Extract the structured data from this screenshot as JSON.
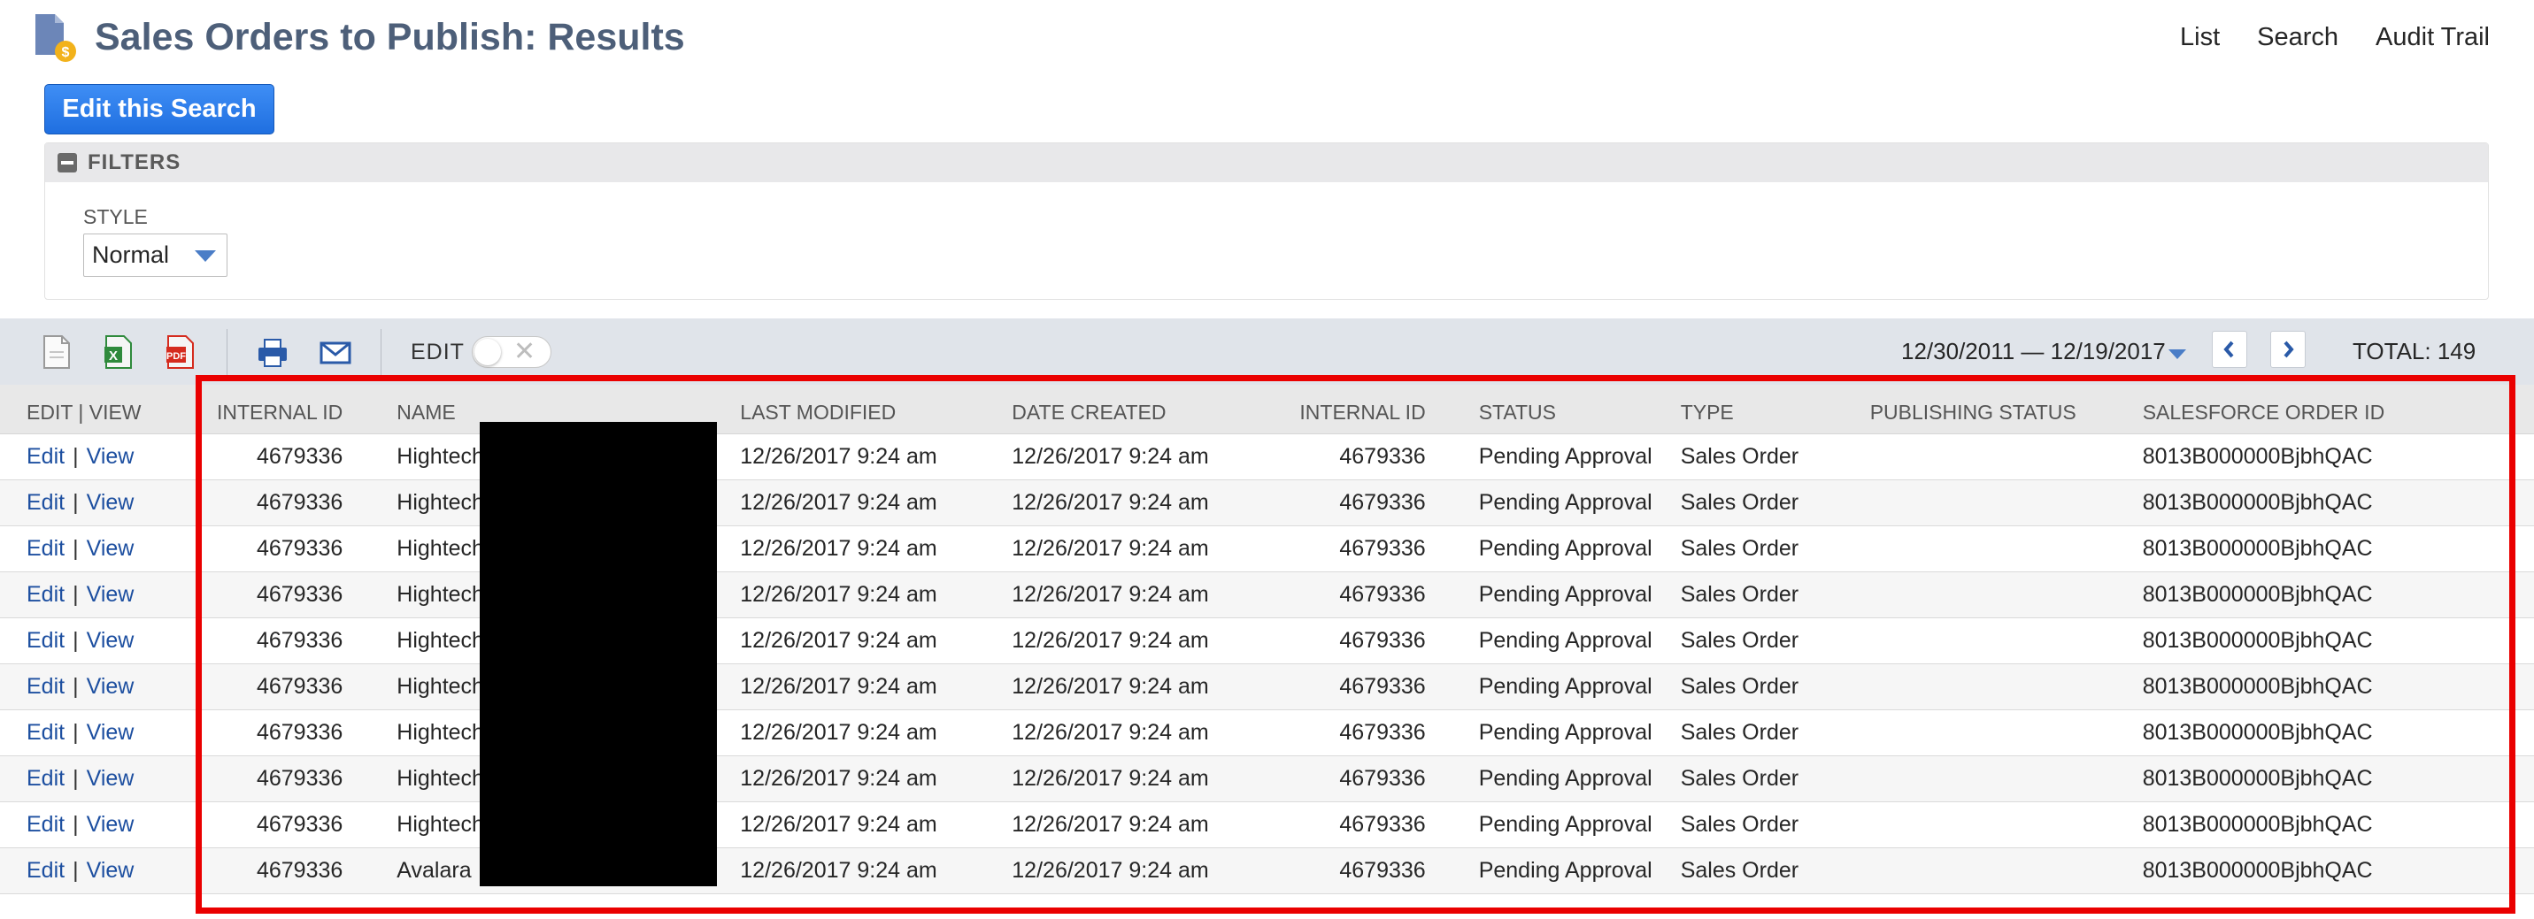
{
  "header": {
    "title": "Sales Orders to Publish: Results",
    "links": [
      "List",
      "Search",
      "Audit Trail"
    ],
    "edit_search_label": "Edit this Search"
  },
  "filters": {
    "title": "FILTERS",
    "style_label": "STYLE",
    "style_value": "Normal"
  },
  "toolbar": {
    "icons": [
      "export-csv-icon",
      "export-excel-icon",
      "export-pdf-icon",
      "print-icon",
      "email-icon"
    ],
    "edit_label": "EDIT",
    "date_range": "12/30/2011 — 12/19/2017",
    "total": "TOTAL: 149"
  },
  "table": {
    "columns": [
      "EDIT | VIEW",
      "INTERNAL ID",
      "NAME",
      "LAST MODIFIED",
      "DATE CREATED",
      "INTERNAL ID",
      "STATUS",
      "TYPE",
      "PUBLISHING STATUS",
      "SALESFORCE ORDER ID"
    ],
    "edit_label": "Edit",
    "view_label": "View",
    "separator": "|",
    "rows": [
      {
        "id": "4679336",
        "name": "Hightech",
        "last_modified": "12/26/2017 9:24 am",
        "date_created": "12/26/2017 9:24 am",
        "id2": "4679336",
        "status": "Pending Approval",
        "type": "Sales Order",
        "publishing_status": "",
        "sf_order_id": "8013B000000BjbhQAC"
      },
      {
        "id": "4679336",
        "name": "Hightech",
        "last_modified": "12/26/2017 9:24 am",
        "date_created": "12/26/2017 9:24 am",
        "id2": "4679336",
        "status": "Pending Approval",
        "type": "Sales Order",
        "publishing_status": "",
        "sf_order_id": "8013B000000BjbhQAC"
      },
      {
        "id": "4679336",
        "name": "Hightech",
        "last_modified": "12/26/2017 9:24 am",
        "date_created": "12/26/2017 9:24 am",
        "id2": "4679336",
        "status": "Pending Approval",
        "type": "Sales Order",
        "publishing_status": "",
        "sf_order_id": "8013B000000BjbhQAC"
      },
      {
        "id": "4679336",
        "name": "Hightech",
        "last_modified": "12/26/2017 9:24 am",
        "date_created": "12/26/2017 9:24 am",
        "id2": "4679336",
        "status": "Pending Approval",
        "type": "Sales Order",
        "publishing_status": "",
        "sf_order_id": "8013B000000BjbhQAC"
      },
      {
        "id": "4679336",
        "name": "Hightech",
        "last_modified": "12/26/2017 9:24 am",
        "date_created": "12/26/2017 9:24 am",
        "id2": "4679336",
        "status": "Pending Approval",
        "type": "Sales Order",
        "publishing_status": "",
        "sf_order_id": "8013B000000BjbhQAC"
      },
      {
        "id": "4679336",
        "name": "Hightech",
        "last_modified": "12/26/2017 9:24 am",
        "date_created": "12/26/2017 9:24 am",
        "id2": "4679336",
        "status": "Pending Approval",
        "type": "Sales Order",
        "publishing_status": "",
        "sf_order_id": "8013B000000BjbhQAC"
      },
      {
        "id": "4679336",
        "name": "Hightech",
        "last_modified": "12/26/2017 9:24 am",
        "date_created": "12/26/2017 9:24 am",
        "id2": "4679336",
        "status": "Pending Approval",
        "type": "Sales Order",
        "publishing_status": "",
        "sf_order_id": "8013B000000BjbhQAC"
      },
      {
        "id": "4679336",
        "name": "Hightech",
        "last_modified": "12/26/2017 9:24 am",
        "date_created": "12/26/2017 9:24 am",
        "id2": "4679336",
        "status": "Pending Approval",
        "type": "Sales Order",
        "publishing_status": "",
        "sf_order_id": "8013B000000BjbhQAC"
      },
      {
        "id": "4679336",
        "name": "Hightech",
        "last_modified": "12/26/2017 9:24 am",
        "date_created": "12/26/2017 9:24 am",
        "id2": "4679336",
        "status": "Pending Approval",
        "type": "Sales Order",
        "publishing_status": "",
        "sf_order_id": "8013B000000BjbhQAC"
      },
      {
        "id": "4679336",
        "name": "Avalara",
        "last_modified": "12/26/2017 9:24 am",
        "date_created": "12/26/2017 9:24 am",
        "id2": "4679336",
        "status": "Pending Approval",
        "type": "Sales Order",
        "publishing_status": "",
        "sf_order_id": "8013B000000BjbhQAC"
      }
    ]
  },
  "colors": {
    "title": "#4d5f79",
    "button": "#1f6fe0",
    "link": "#1d4fa0",
    "highlight": "#ea0000",
    "toolbar_bg": "#e0e4ea"
  }
}
